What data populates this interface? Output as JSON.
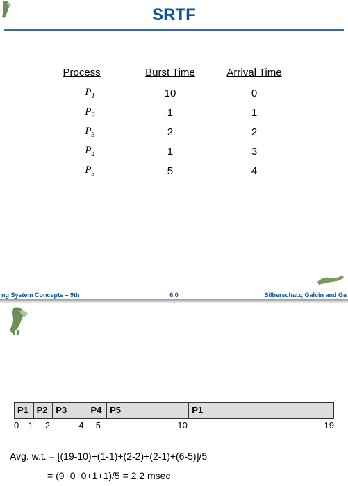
{
  "slide_top": {
    "title": "SRTF",
    "table": {
      "headers": [
        "Process",
        "Burst Time",
        "Arrival Time"
      ],
      "rows": [
        {
          "process": "P",
          "sub": "1",
          "burst": "10",
          "arrival": "0"
        },
        {
          "process": "P",
          "sub": "2",
          "burst": "1",
          "arrival": "1"
        },
        {
          "process": "P",
          "sub": "3",
          "burst": "2",
          "arrival": "2"
        },
        {
          "process": "P",
          "sub": "4",
          "burst": "1",
          "arrival": "3"
        },
        {
          "process": "P",
          "sub": "5",
          "burst": "5",
          "arrival": "4"
        }
      ]
    },
    "footer": {
      "left": "ng System Concepts – 9th",
      "center": "6.0",
      "right": "Silberschatz, Galvin and Ga"
    }
  },
  "slide_bottom": {
    "gantt": {
      "total": 19,
      "segments": [
        {
          "label": "P1",
          "start": 0,
          "end": 1
        },
        {
          "label": "P2",
          "start": 1,
          "end": 2
        },
        {
          "label": "P3",
          "start": 2,
          "end": 4
        },
        {
          "label": "P4",
          "start": 4,
          "end": 5
        },
        {
          "label": "P5",
          "start": 5,
          "end": 10
        },
        {
          "label": "P1",
          "start": 10,
          "end": 19
        }
      ],
      "ticks": [
        "0",
        "1",
        "2",
        "4",
        "5",
        "10",
        "19"
      ]
    },
    "calc": {
      "line1": "Avg. w.t. = [(19-10)+(1-1)+(2-2)+(2-1)+(6-5)]/5",
      "line2": "= (9+0+0+1+1)/5 = 2.2 msec"
    }
  },
  "chart_data": {
    "type": "table",
    "title": "SRTF",
    "columns": [
      "Process",
      "Burst Time",
      "Arrival Time"
    ],
    "rows": [
      [
        "P1",
        10,
        0
      ],
      [
        "P2",
        1,
        1
      ],
      [
        "P3",
        2,
        2
      ],
      [
        "P4",
        1,
        3
      ],
      [
        "P5",
        5,
        4
      ]
    ],
    "gantt": {
      "axis": "time",
      "range": [
        0,
        19
      ],
      "segments": [
        {
          "process": "P1",
          "start": 0,
          "end": 1
        },
        {
          "process": "P2",
          "start": 1,
          "end": 2
        },
        {
          "process": "P3",
          "start": 2,
          "end": 4
        },
        {
          "process": "P4",
          "start": 4,
          "end": 5
        },
        {
          "process": "P5",
          "start": 5,
          "end": 10
        },
        {
          "process": "P1",
          "start": 10,
          "end": 19
        }
      ]
    },
    "avg_waiting_time_msec": 2.2
  }
}
